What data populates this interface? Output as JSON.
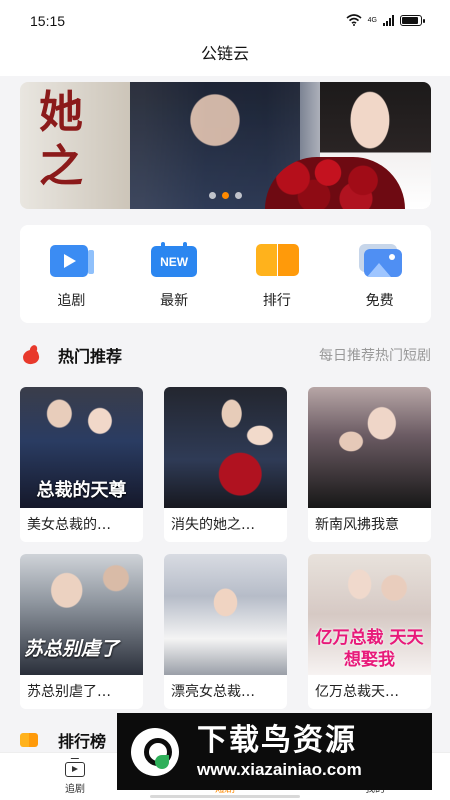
{
  "status_bar": {
    "time": "15:15",
    "signal_label": "4G",
    "battery_level": 0.9
  },
  "header": {
    "title": "公链云"
  },
  "banner": {
    "overlay_text": "她之",
    "slide_count": 3,
    "active_slide": 2
  },
  "quick_nav": [
    {
      "label": "追剧",
      "icon": "play-folder-icon"
    },
    {
      "label": "最新",
      "icon": "new-badge-icon"
    },
    {
      "label": "排行",
      "icon": "ranking-book-icon"
    },
    {
      "label": "免费",
      "icon": "picture-icon"
    }
  ],
  "hot_section": {
    "title": "热门推荐",
    "subtitle": "每日推荐热门短剧",
    "items": [
      {
        "title": "美女总裁的…",
        "poster_text": "总裁的天尊"
      },
      {
        "title": "消失的她之…",
        "poster_text": ""
      },
      {
        "title": "新南风拂我意",
        "poster_text": ""
      },
      {
        "title": "苏总别虐了…",
        "poster_text": "苏总别虐了"
      },
      {
        "title": "漂亮女总裁…",
        "poster_text": ""
      },
      {
        "title": "亿万总裁天…",
        "poster_text": "亿万总裁 天天想娶我"
      }
    ]
  },
  "ranking_section": {
    "title": "排行榜"
  },
  "tab_bar": [
    {
      "label": "追剧",
      "icon": "tv-icon"
    },
    {
      "label": "短剧",
      "icon": "short-drama-icon"
    },
    {
      "label": "我的",
      "icon": "person-icon"
    }
  ],
  "watermark": {
    "title": "下载鸟资源",
    "url": "www.xiazainiao.com"
  },
  "colors": {
    "accent": "#ff8a00",
    "hot_icon": "#e8392c",
    "primary_blue": "#2b86f0"
  }
}
